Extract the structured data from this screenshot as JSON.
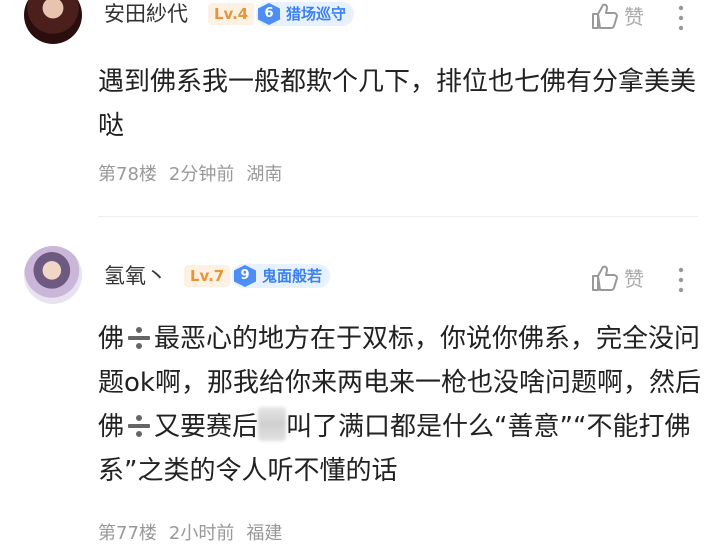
{
  "comments": [
    {
      "username": "安田紗代",
      "level": "Lv.4",
      "badge_number": "6",
      "badge_label": "猎场巡守",
      "like_label": "赞",
      "content": "遇到佛系我一般都欺个几下，排位也七佛有分拿美美哒",
      "floor": "第78楼",
      "time": "2分钟前",
      "location": "湖南"
    },
    {
      "username": "氢氧丶",
      "level": "Lv.7",
      "badge_number": "9",
      "badge_label": "鬼面般若",
      "like_label": "赞",
      "content_part1": "佛",
      "content_part2": "最恶心的地方在于双标，你说你佛系，完全没问题ok啊，那我给你来两电来一枪也没啥问题啊，然后佛",
      "content_part3": "又要赛后",
      "content_part4": "叫了满口都是什么“善意”“不能打佛系”之类的令人听不懂的话",
      "floor": "第77楼",
      "time": "2小时前",
      "location": "福建"
    }
  ],
  "colors": {
    "level_text": "#e8953a",
    "badge_bg": "#e8f1ff",
    "badge_text": "#3b82f0",
    "meta_text": "#999999"
  },
  "icons": [
    "thumbs-up-icon",
    "more-vertical-icon",
    "divide-emoji-icon"
  ]
}
